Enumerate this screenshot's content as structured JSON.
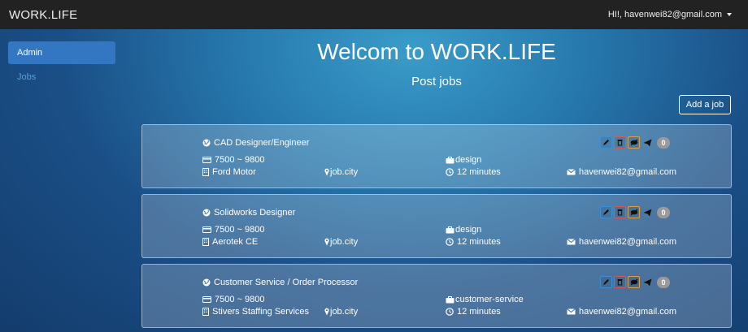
{
  "navbar": {
    "brand": "WORK.LIFE",
    "user_greeting": "HI!, havenwei82@gmail.com"
  },
  "sidebar": {
    "items": [
      {
        "label": "Admin",
        "active": true
      },
      {
        "label": "Jobs",
        "active": false
      }
    ]
  },
  "main": {
    "welcome": "Welcom to WORK.LIFE",
    "subtitle": "Post jobs",
    "add_button": "Add a job"
  },
  "jobs": [
    {
      "title": "CAD Designer/Engineer",
      "salary": "7500 ~ 9800",
      "company": "Ford Motor",
      "location": "job.city",
      "category": "design",
      "time": "12 minutes",
      "email": "havenwei82@gmail.com",
      "count": "0"
    },
    {
      "title": "Solidworks Designer",
      "salary": "7500 ~ 9800",
      "company": "Aerotek CE",
      "location": "job.city",
      "category": "design",
      "time": "12 minutes",
      "email": "havenwei82@gmail.com",
      "count": "0"
    },
    {
      "title": "Customer Service / Order Processor",
      "salary": "7500 ~ 9800",
      "company": "Stivers Staffing Services",
      "location": "job.city",
      "category": "customer-service",
      "time": "12 minutes",
      "email": "havenwei82@gmail.com",
      "count": "0"
    }
  ],
  "icons": {
    "title": "globe-icon",
    "salary": "credit-card-icon",
    "company": "building-icon",
    "location": "map-marker-icon",
    "category": "briefcase-icon",
    "time": "clock-icon",
    "email": "envelope-icon"
  },
  "colors": {
    "navbar": "#222222",
    "active_sidebar": "#3376c2",
    "sidebar_link": "#4fa3dd",
    "edit": "#3b8ed8",
    "delete": "#d25a5a",
    "view": "#e0a040"
  }
}
